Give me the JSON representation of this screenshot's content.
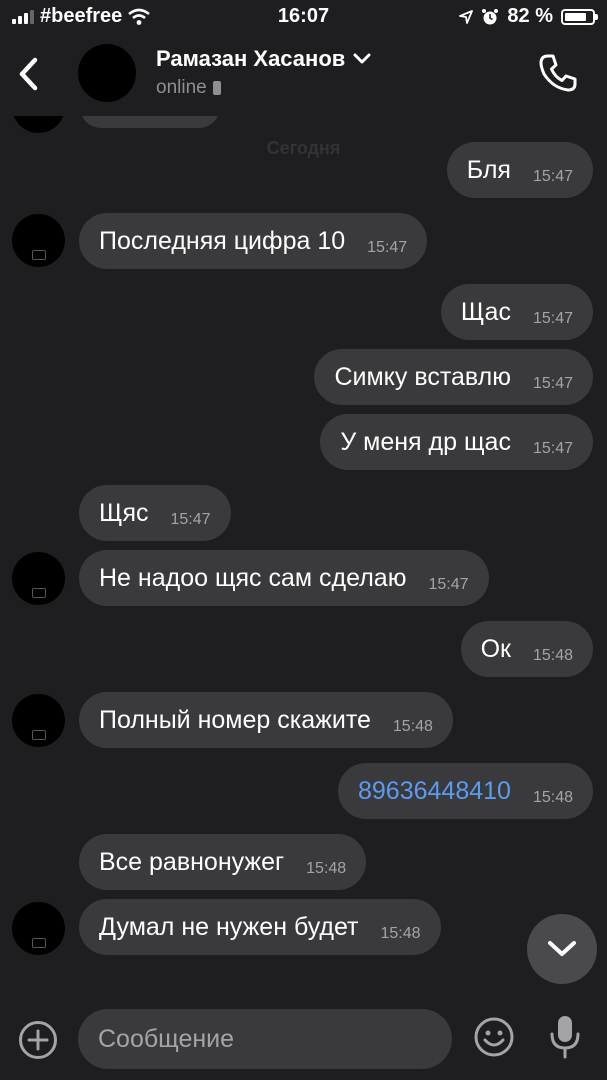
{
  "status_bar": {
    "carrier": "#beefree",
    "time": "16:07",
    "battery_percent": "82 %",
    "battery_level": 0.82
  },
  "header": {
    "contact_name": "Рамазан Хасанов",
    "status": "online",
    "icons": {
      "back": "chevron-left-icon",
      "expand": "chevron-down-icon",
      "call": "phone-icon"
    }
  },
  "chat": {
    "date_separator": "Сегодня",
    "messages": [
      {
        "side": "out",
        "text": "Бля",
        "time": "15:47"
      },
      {
        "side": "in",
        "text": "Последняя цифра 10",
        "time": "15:47"
      },
      {
        "side": "out",
        "text": "Щас",
        "time": "15:47"
      },
      {
        "side": "out",
        "text": "Симку вставлю",
        "time": "15:47"
      },
      {
        "side": "out",
        "text": "У меня др щас",
        "time": "15:47"
      },
      {
        "side": "in",
        "text": "Щяс",
        "time": "15:47"
      },
      {
        "side": "in",
        "text": "Не надоо щяс сам сделаю",
        "time": "15:47"
      },
      {
        "side": "out",
        "text": "Ок",
        "time": "15:48"
      },
      {
        "side": "in",
        "text": "Полный номер скажите",
        "time": "15:48"
      },
      {
        "side": "out",
        "text": "89636448410",
        "time": "15:48",
        "is_link": true
      },
      {
        "side": "in",
        "text": "Все равнонужег",
        "time": "15:48"
      },
      {
        "side": "in",
        "text": "Думал не нужен будет",
        "time": "15:48"
      }
    ]
  },
  "composer": {
    "placeholder": "Сообщение",
    "icons": {
      "attach": "plus-circle-icon",
      "emoji": "smiley-icon",
      "mic": "microphone-icon"
    }
  },
  "colors": {
    "background": "#1e1e20",
    "bubble": "#3a3a3d",
    "link": "#5b9bf0",
    "time_text": "#a3a3a8"
  }
}
